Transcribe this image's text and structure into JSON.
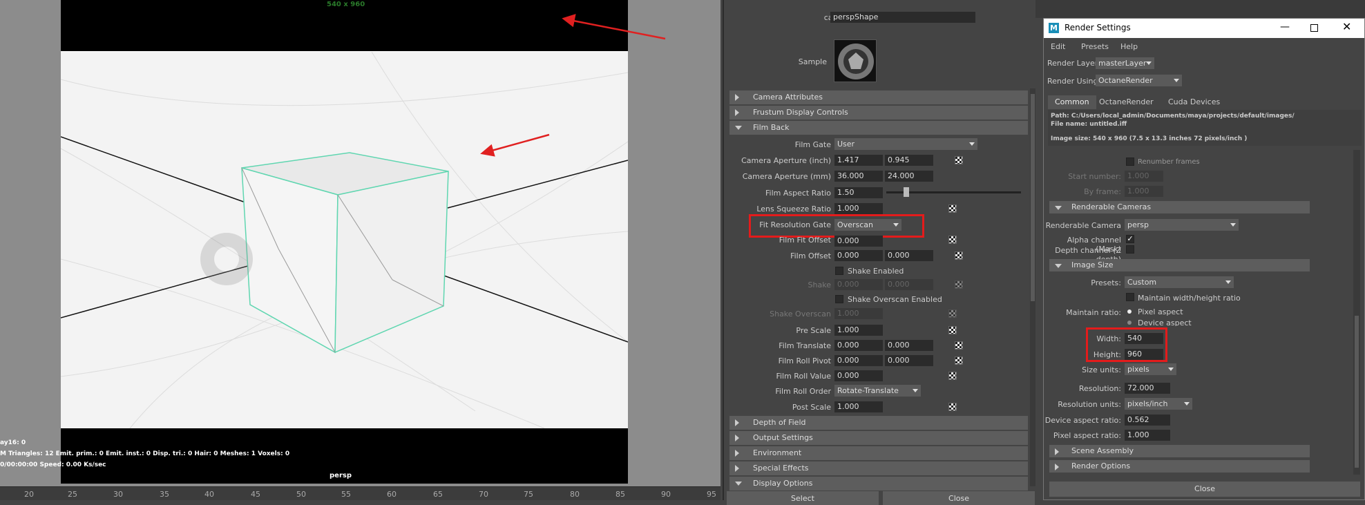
{
  "viewport": {
    "resolution_label": "540 x 960",
    "hud_line1": "ay16: 0",
    "hud_line2": "M Triangles: 12 Emit. prim.: 0 Emit. inst.: 0 Disp. tri.: 0 Hair: 0 Meshes: 1 Voxels: 0",
    "hud_line3": "0/00:00:00 Speed: 0.00 Ks/sec",
    "camera_name": "persp",
    "timeline_ticks": [
      "20",
      "25",
      "30",
      "35",
      "40",
      "45",
      "50",
      "55",
      "60",
      "65",
      "70",
      "75",
      "80",
      "85",
      "90",
      "95"
    ]
  },
  "attribute_editor": {
    "camera_label": "camera:",
    "camera_value": "perspShape",
    "sample_label": "Sample",
    "sections_top": [
      "Camera Attributes",
      "Frustum Display Controls",
      "Film Back"
    ],
    "film_gate_label": "Film Gate",
    "film_gate_value": "User",
    "camera_aperture_inch_label": "Camera Aperture (inch)",
    "camera_aperture_inch": [
      "1.417",
      "0.945"
    ],
    "camera_aperture_mm_label": "Camera Aperture (mm)",
    "camera_aperture_mm": [
      "36.000",
      "24.000"
    ],
    "film_aspect_ratio_label": "Film Aspect Ratio",
    "film_aspect_ratio": "1.50",
    "lens_squeeze_label": "Lens Squeeze Ratio",
    "lens_squeeze": "1.000",
    "fit_resolution_gate_label": "Fit Resolution Gate",
    "fit_resolution_gate": "Overscan",
    "film_fit_offset_label": "Film Fit Offset",
    "film_fit_offset": "0.000",
    "film_offset_label": "Film Offset",
    "film_offset": [
      "0.000",
      "0.000"
    ],
    "shake_enabled_label": "Shake Enabled",
    "shake_label": "Shake",
    "shake": [
      "0.000",
      "0.000"
    ],
    "shake_overscan_enabled_label": "Shake Overscan Enabled",
    "shake_overscan_label": "Shake Overscan",
    "shake_overscan": "1.000",
    "pre_scale_label": "Pre Scale",
    "pre_scale": "1.000",
    "film_translate_label": "Film Translate",
    "film_translate": [
      "0.000",
      "0.000"
    ],
    "film_roll_pivot_label": "Film Roll Pivot",
    "film_roll_pivot": [
      "0.000",
      "0.000"
    ],
    "film_roll_value_label": "Film Roll Value",
    "film_roll_value": "0.000",
    "film_roll_order_label": "Film Roll Order",
    "film_roll_order": "Rotate-Translate",
    "post_scale_label": "Post Scale",
    "post_scale": "1.000",
    "sections_bottom": [
      "Depth of Field",
      "Output Settings",
      "Environment",
      "Special Effects",
      "Display Options"
    ],
    "select_button": "Select",
    "close_button": "Close"
  },
  "render_settings": {
    "title": "Render Settings",
    "menu": [
      "Edit",
      "Presets",
      "Help"
    ],
    "render_layer_label": "Render Layer",
    "render_layer": "masterLayer",
    "render_using_label": "Render Using",
    "render_using": "OctaneRender",
    "tabs": [
      "Common",
      "OctaneRender",
      "Cuda Devices"
    ],
    "path": "Path: C:/Users/local_admin/Documents/maya/projects/default/images/",
    "file_name": "File name:  untitled.iff",
    "image_size_info": "Image size: 540 x 960 (7.5 x 13.3 inches 72 pixels/inch )",
    "renumber_frames": "Renumber frames",
    "start_number_label": "Start number:",
    "start_number": "1.000",
    "by_frame_label": "By frame:",
    "by_frame": "1.000",
    "renderable_cameras_header": "Renderable Cameras",
    "renderable_camera_label": "Renderable Camera",
    "renderable_camera": "persp",
    "alpha_label": "Alpha channel (Mask)",
    "depth_label": "Depth channel (Z depth)",
    "image_size_header": "Image Size",
    "presets_label": "Presets:",
    "presets": "Custom",
    "maintain_wh_label": "Maintain width/height ratio",
    "maintain_ratio_label": "Maintain ratio:",
    "pixel_aspect": "Pixel aspect",
    "device_aspect": "Device aspect",
    "width_label": "Width:",
    "width": "540",
    "height_label": "Height:",
    "height": "960",
    "size_units_label": "Size units:",
    "size_units": "pixels",
    "resolution_label": "Resolution:",
    "resolution": "72.000",
    "resolution_units_label": "Resolution units:",
    "resolution_units": "pixels/inch",
    "device_aspect_ratio_label": "Device aspect ratio:",
    "device_aspect_ratio": "0.562",
    "pixel_aspect_ratio_label": "Pixel aspect ratio:",
    "pixel_aspect_ratio": "1.000",
    "scene_assembly": "Scene Assembly",
    "render_options": "Render Options",
    "close_button": "Close"
  }
}
